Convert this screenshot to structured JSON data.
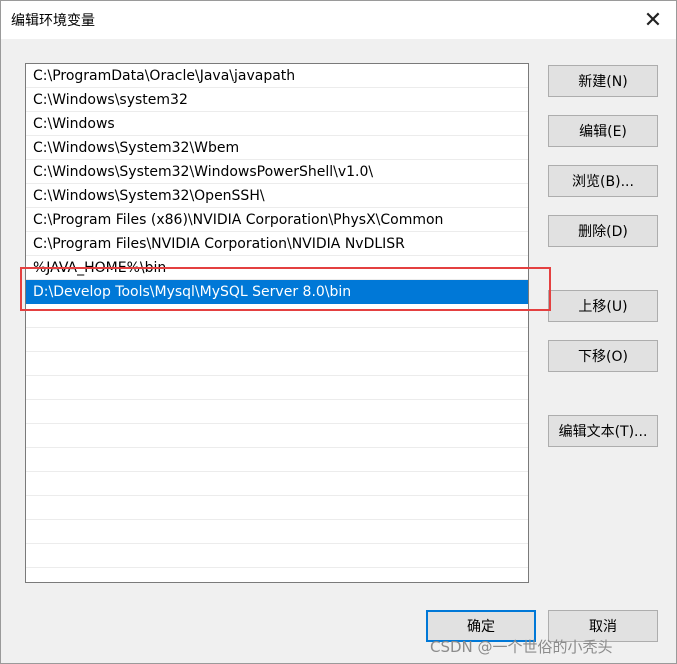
{
  "window": {
    "title": "编辑环境变量",
    "close_glyph": "✕"
  },
  "path_list": {
    "items": [
      {
        "value": "C:\\ProgramData\\Oracle\\Java\\javapath",
        "selected": false
      },
      {
        "value": "C:\\Windows\\system32",
        "selected": false
      },
      {
        "value": "C:\\Windows",
        "selected": false
      },
      {
        "value": "C:\\Windows\\System32\\Wbem",
        "selected": false
      },
      {
        "value": "C:\\Windows\\System32\\WindowsPowerShell\\v1.0\\",
        "selected": false
      },
      {
        "value": "C:\\Windows\\System32\\OpenSSH\\",
        "selected": false
      },
      {
        "value": "C:\\Program Files (x86)\\NVIDIA Corporation\\PhysX\\Common",
        "selected": false
      },
      {
        "value": "C:\\Program Files\\NVIDIA Corporation\\NVIDIA NvDLISR",
        "selected": false
      },
      {
        "value": "%JAVA_HOME%\\bin",
        "selected": false
      },
      {
        "value": "D:\\Develop Tools\\Mysql\\MySQL Server 8.0\\bin",
        "selected": true
      }
    ]
  },
  "buttons": {
    "new": "新建(N)",
    "edit": "编辑(E)",
    "browse": "浏览(B)...",
    "delete": "删除(D)",
    "move_up": "上移(U)",
    "move_down": "下移(O)",
    "edit_text": "编辑文本(T)...",
    "ok": "确定",
    "cancel": "取消"
  },
  "colors": {
    "selection": "#0078d7",
    "annotation_box": "#e44040"
  },
  "watermark": "CSDN @一个世俗的小秃头"
}
